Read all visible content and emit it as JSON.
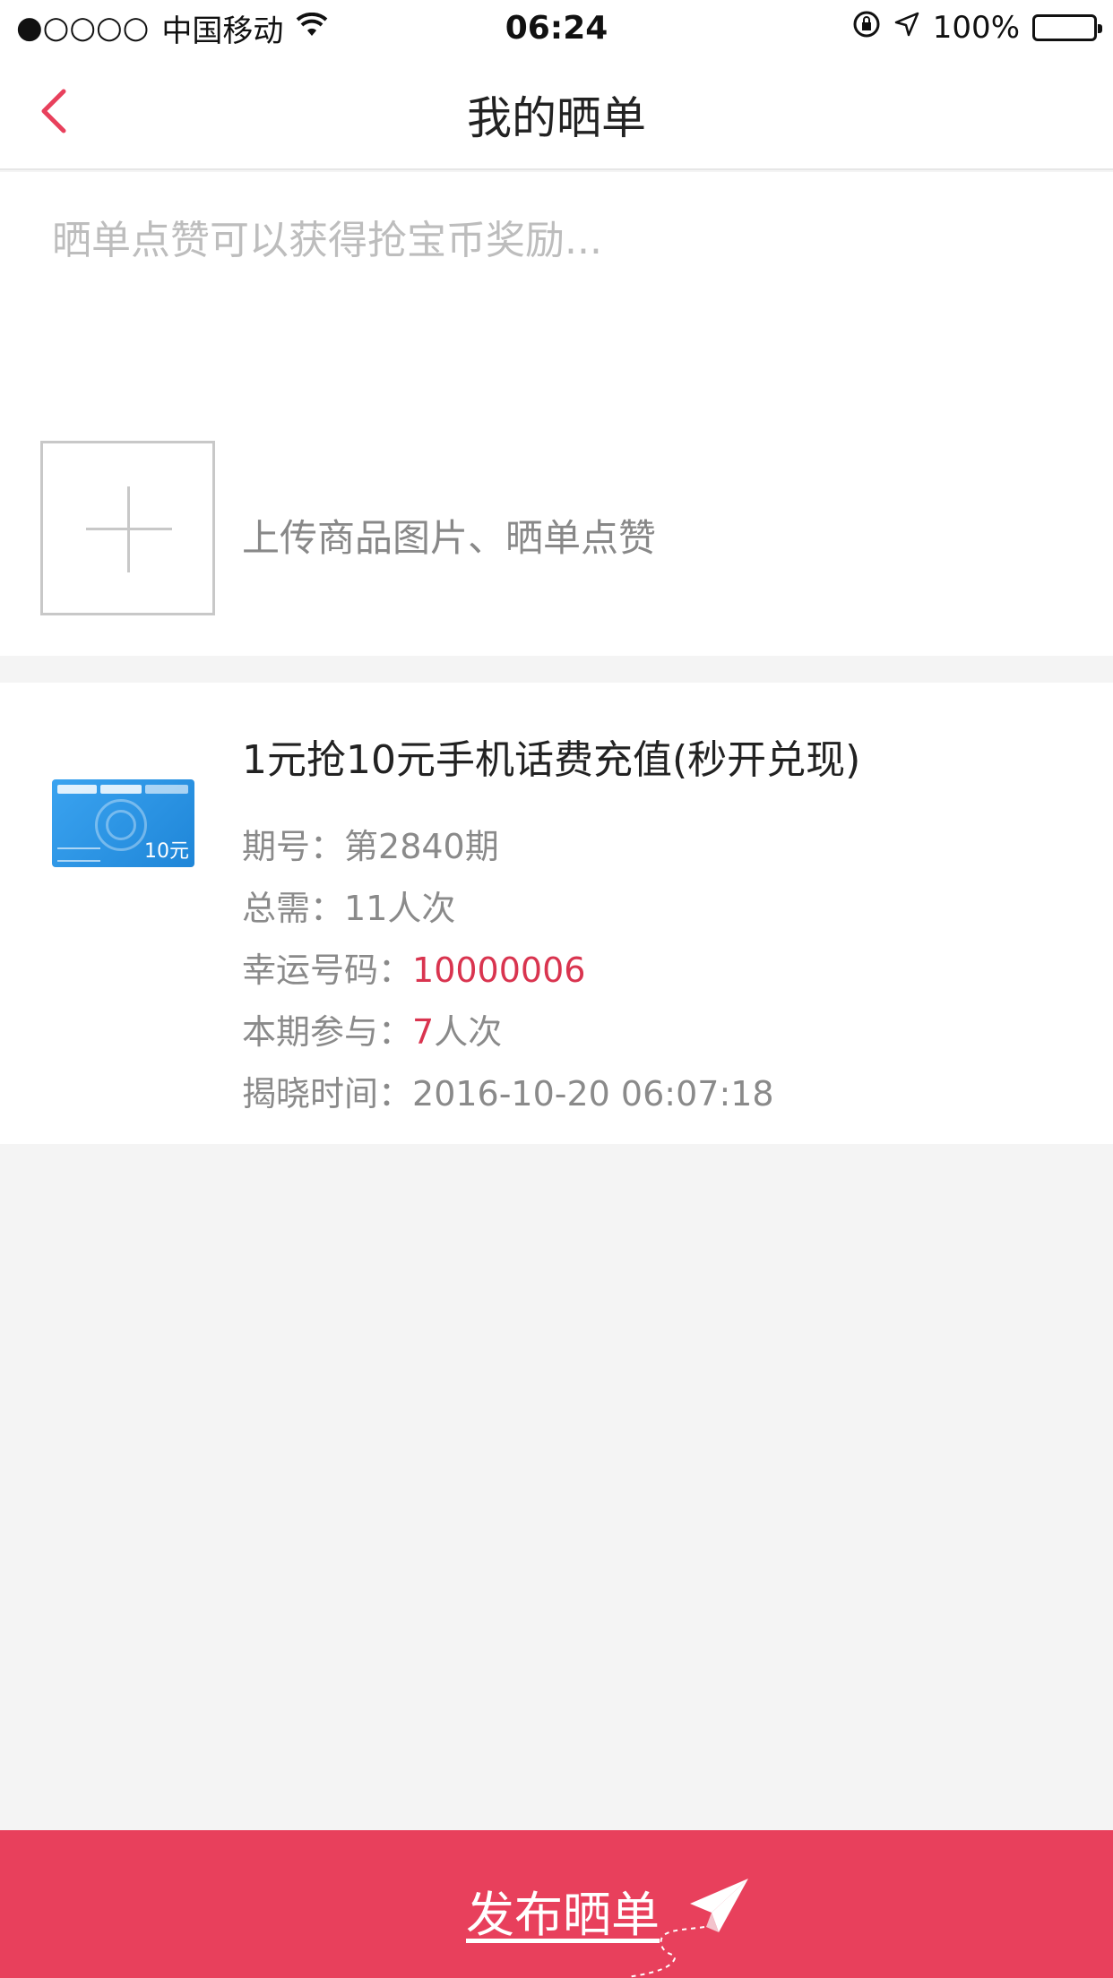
{
  "status_bar": {
    "signal": "●○○○○",
    "carrier": "中国移动",
    "time": "06:24",
    "battery": "100%"
  },
  "nav": {
    "title": "我的晒单"
  },
  "compose": {
    "placeholder": "晒单点赞可以获得抢宝币奖励...",
    "upload_hint": "上传商品图片、晒单点赞"
  },
  "record": {
    "thumb_denomination": "10元",
    "title": "1元抢10元手机话费充值(秒开兑现)",
    "period_label": "期号：",
    "period_value": "第2840期",
    "total_label": "总需：",
    "total_value": "11人次",
    "lucky_label": "幸运号码：",
    "lucky_value": "10000006",
    "participation_label": "本期参与：",
    "participation_count": "7",
    "participation_unit": "人次",
    "reveal_label": "揭晓时间：",
    "reveal_value": "2016-10-20 06:07:18"
  },
  "publish": {
    "label": "发布晒单"
  },
  "colors": {
    "accent": "#e8405c",
    "highlight_red": "#d9344f",
    "text_gray": "#8a8a8a",
    "page_bg": "#f4f4f4"
  }
}
